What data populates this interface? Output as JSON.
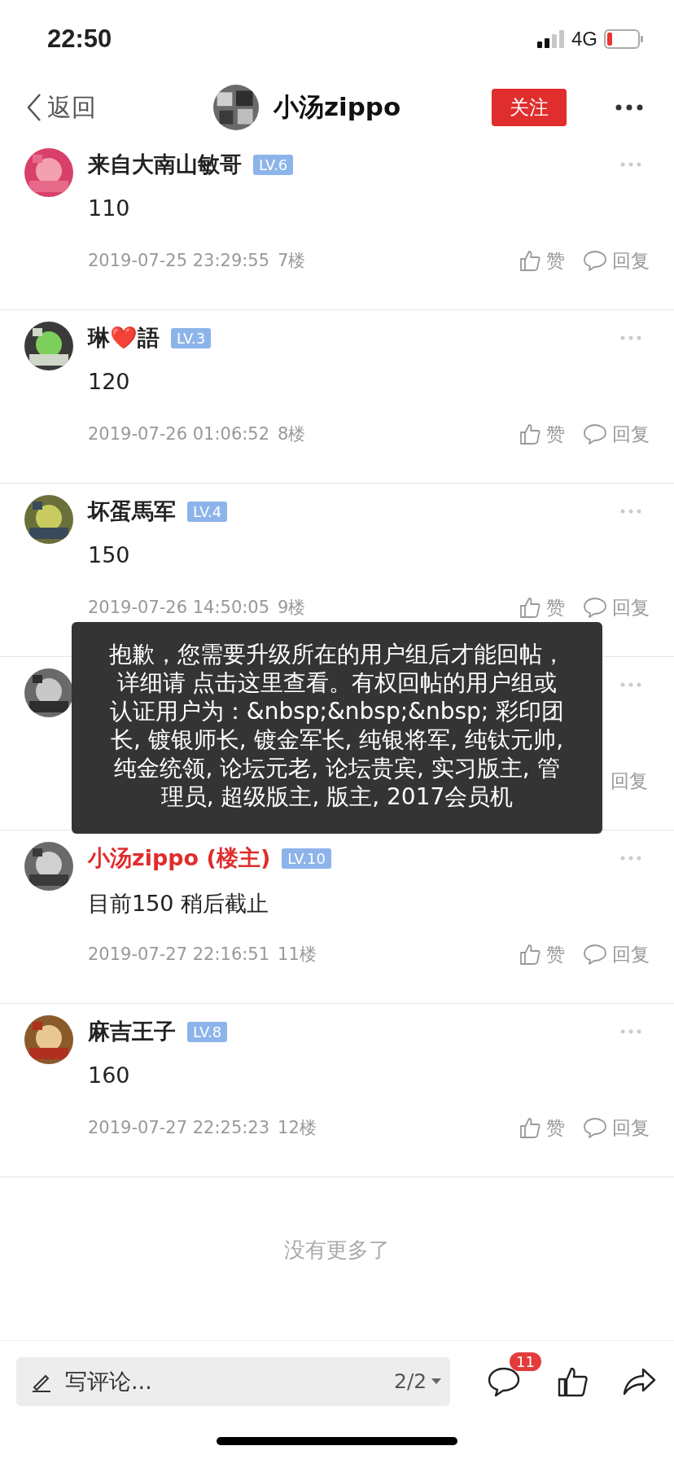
{
  "status_bar": {
    "time": "22:50",
    "network": "4G"
  },
  "nav": {
    "back": "返回",
    "title": "小汤zippo",
    "follow": "关注"
  },
  "comments": [
    {
      "name": "来自大南山敏哥",
      "op": false,
      "level_badge": "LV.6",
      "text": "110",
      "date": "2019-07-25 23:29:55",
      "floor": "7楼",
      "like": "赞",
      "reply": "回复"
    },
    {
      "name": "琳❤️語",
      "op": false,
      "level_badge": "LV.3",
      "text": "120",
      "date": "2019-07-26 01:06:52",
      "floor": "8楼",
      "like": "赞",
      "reply": "回复"
    },
    {
      "name": "坏蛋馬军",
      "op": false,
      "level_badge": "LV.4",
      "text": "150",
      "date": "2019-07-26 14:50:05",
      "floor": "9楼",
      "like": "赞",
      "reply": "回复"
    },
    {
      "covered": true,
      "reply": "回复"
    },
    {
      "name": "小汤zippo (楼主)",
      "op": true,
      "level_badge": "LV.10",
      "text": "目前150 稍后截止",
      "date": "2019-07-27 22:16:51",
      "floor": "11楼",
      "like": "赞",
      "reply": "回复"
    },
    {
      "name": "麻吉王子",
      "op": false,
      "level_badge": "LV.8",
      "text": "160",
      "date": "2019-07-27 22:25:23",
      "floor": "12楼",
      "like": "赞",
      "reply": "回复"
    }
  ],
  "end_note": "没有更多了",
  "toast": "抱歉，您需要升级所在的用户组后才能回帖，详细请 点击这里查看。有权回帖的用户组或认证用户为：&nbsp;&nbsp;&nbsp; 彩印团长, 镀银师长, 镀金军长, 纯银将军, 纯钛元帅, 纯金统领, 论坛元老, 论坛贵宾, 实习版主, 管理员, 超级版主, 版主, 2017会员机",
  "bottom_bar": {
    "placeholder": "写评论...",
    "page": "2/2",
    "comment_count": "11"
  }
}
